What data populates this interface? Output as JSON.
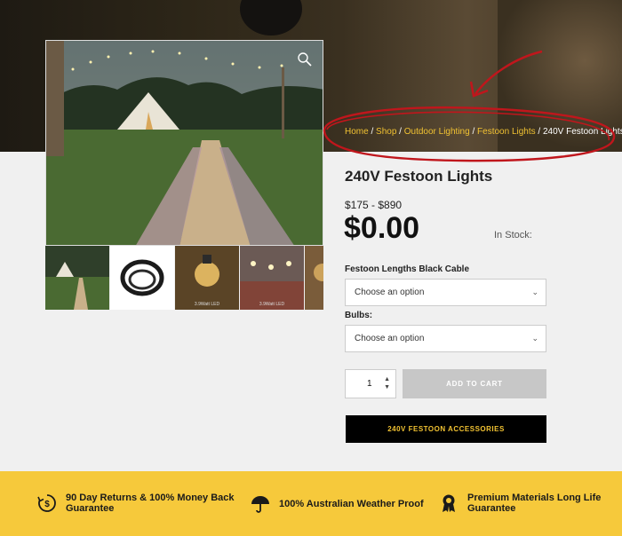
{
  "breadcrumb": {
    "home": "Home",
    "shop": "Shop",
    "outdoor": "Outdoor Lighting",
    "festoon": "Festoon Lights",
    "current": "240V Festoon Lights",
    "sep": "/"
  },
  "product": {
    "title": "240V Festoon Lights",
    "price_range": "$175 - $890",
    "price": "$0.00",
    "stock": "In Stock:"
  },
  "options": {
    "lengths_label": "Festoon Lengths Black Cable",
    "lengths_value": "Choose an option",
    "bulbs_label": "Bulbs:",
    "bulbs_value": "Choose an option"
  },
  "cart": {
    "quantity": "1",
    "add_label": "ADD TO CART"
  },
  "accessories_label": "240V FESTOON ACCESSORIES",
  "thumbnails": [
    {
      "caption": ""
    },
    {
      "caption": ""
    },
    {
      "caption": "3.9Watt LED"
    },
    {
      "caption": "3.9Watt LED"
    },
    {
      "caption": ""
    }
  ],
  "features": [
    {
      "icon": "money-back-icon",
      "text": "90 Day Returns & 100% Money Back Guarantee"
    },
    {
      "icon": "umbrella-icon",
      "text": "100% Australian Weather Proof"
    },
    {
      "icon": "award-ribbon-icon",
      "text": "Premium Materials Long Life Guarantee"
    }
  ],
  "colors": {
    "accent_yellow": "#f1c232",
    "footer_yellow": "#f6c93b",
    "annotation_red": "#c0161c"
  }
}
